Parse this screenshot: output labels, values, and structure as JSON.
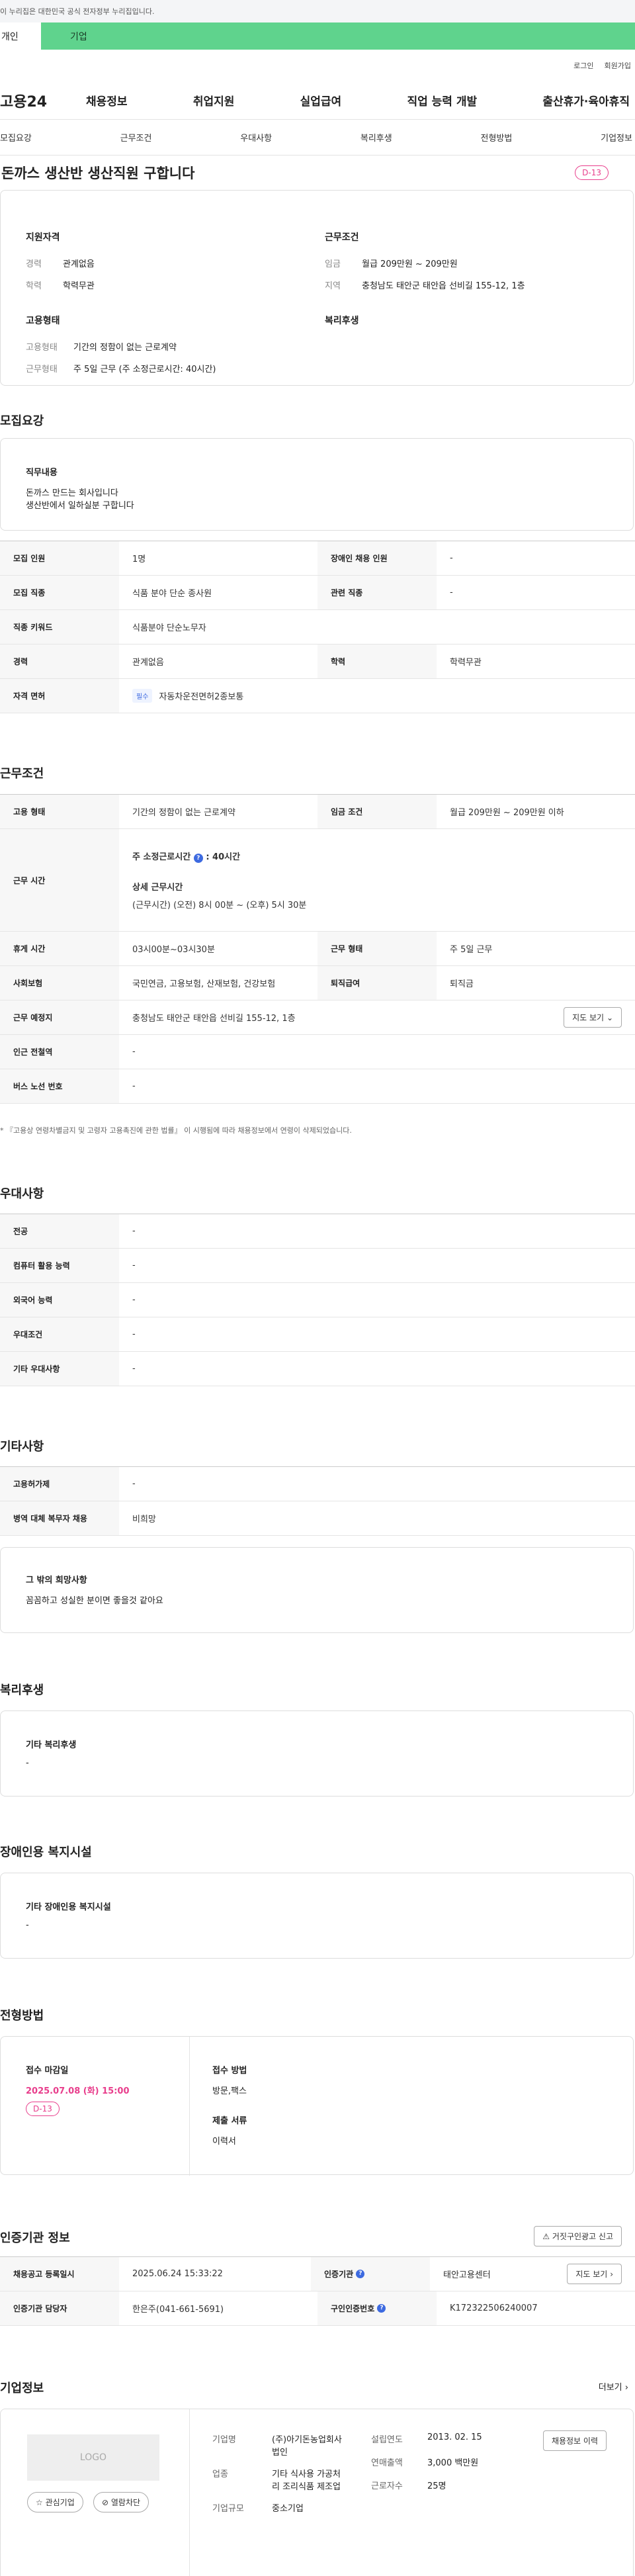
{
  "notice": "이 누리집은 대한민국 공식 전자정부 누리집입니다.",
  "orgtabs": [
    "개인",
    "기업"
  ],
  "util": [
    "로그인",
    "회원가입"
  ],
  "logo": "고용24",
  "gnb": [
    "채용정보",
    "취업지원",
    "실업급여",
    "직업 능력 개발",
    "출산휴가·육아휴직"
  ],
  "subnav": [
    "모집요강",
    "근무조건",
    "우대사항",
    "복리후생",
    "전형방법",
    "기업정보"
  ],
  "title": "돈까스 생산반 생산직원 구합니다",
  "dday": "D-13",
  "summary": {
    "qual_title": "지원자격",
    "career_k": "경력",
    "career_v": "관계없음",
    "edu_k": "학력",
    "edu_v": "학력무관",
    "emp_title": "고용형태",
    "emp1_k": "고용형태",
    "emp1_v": "기간의 정함이 없는 근로계약",
    "emp2_k": "근무형태",
    "emp2_v": "주 5일 근무 (주 소정근로시간: 40시간)",
    "work_title": "근무조건",
    "wage_k": "임금",
    "wage_v": "월급 209만원 ~ 209만원",
    "area_k": "지역",
    "area_v": "충청남도 태안군 태안읍 선비길 155-12, 1층",
    "welfare_title": "복리후생"
  },
  "recruit": {
    "title": "모집요강",
    "duty_title": "직무내용",
    "duty1": "돈까스 만드는 회사입니다",
    "duty2": "생산반에서 일하실분 구합니다",
    "rows": [
      {
        "k1": "모집 인원",
        "v1": "1명",
        "k2": "장애인 채용 인원",
        "v2": "-"
      },
      {
        "k1": "모집 직종",
        "v1": "식품 분야 단순 종사원",
        "k2": "관련 직종",
        "v2": "-"
      },
      {
        "k": "직종 키워드",
        "v": "식품분야 단순노무자"
      },
      {
        "k1": "경력",
        "v1": "관계없음",
        "k2": "학력",
        "v2": "학력무관"
      }
    ],
    "lic_k": "자격 면허",
    "lic_tag": "필수",
    "lic_v": "자동차운전면허2종보통"
  },
  "cond": {
    "title": "근무조건",
    "emp_k": "고용 형태",
    "emp_v": "기간의 정함이 없는 근로계약",
    "wage_k": "임금 조건",
    "wage_v": "월급 209만원 ~ 209만원 이하",
    "time_k": "근무 시간",
    "time_l1": "주 소정근로시간",
    "time_l1v": ": 40시간",
    "time_l2": "상세 근무시간",
    "time_l3": "(근무시간) (오전) 8시 00분 ~ (오후) 5시 30분",
    "rest_k": "휴게 시간",
    "rest_v": "03시00분~03시30분",
    "form_k": "근무 형태",
    "form_v": "주 5일 근무",
    "ins_k": "사회보험",
    "ins_v": "국민연금, 고용보험, 산재보험, 건강보험",
    "ret_k": "퇴직급여",
    "ret_v": "퇴직금",
    "place_k": "근무 예정지",
    "place_v": "충청남도 태안군 태안읍 선비길 155-12, 1층",
    "map": "지도 보기",
    "sub_k": "인근 전철역",
    "sub_v": "-",
    "bus_k": "버스 노선 번호",
    "bus_v": "-",
    "note": "* 『고용상 연령차별금지 및 고령자 고용촉진에 관한 법률』 이 시행됨에 따라 채용정보에서 연령이 삭제되었습니다."
  },
  "pref": {
    "title": "우대사항",
    "rows": [
      {
        "k": "전공",
        "v": "-"
      },
      {
        "k": "컴퓨터 활용 능력",
        "v": "-"
      },
      {
        "k": "외국어 능력",
        "v": "-"
      },
      {
        "k": "우대조건",
        "v": "-"
      },
      {
        "k": "기타 우대사항",
        "v": "-"
      }
    ]
  },
  "etc": {
    "title": "기타사항",
    "rows": [
      {
        "k": "고용허가제",
        "v": "-"
      },
      {
        "k": "병역 대체 복무자 채용",
        "v": "비희망"
      }
    ],
    "hope_title": "그 밖의 희망사항",
    "hope_v": "꼼꼼하고 성실한 분이면 좋을것 같아요"
  },
  "welfare": {
    "title": "복리후생",
    "sub": "기타 복리후생",
    "v": "-"
  },
  "disab": {
    "title": "장애인용 복지시설",
    "sub": "기타 장애인용 복지시설",
    "v": "-"
  },
  "select": {
    "title": "전형방법",
    "deadline_k": "접수 마감일",
    "deadline_v": "2025.07.08 (화) 15:00",
    "dday": "D-13",
    "method_k": "접수 방법",
    "method_v": "방문,팩스",
    "docs_k": "제출 서류",
    "docs_v": "이력서"
  },
  "auth": {
    "title": "인증기관 정보",
    "report": "거짓구인광고 신고",
    "reg_k": "채용공고 등록일시",
    "reg_v": "2025.06.24 15:33:22",
    "org_k": "인증기관",
    "org_v": "태안고용센터",
    "map": "지도 보기",
    "mgr_k": "인증기관 담당자",
    "mgr_v": "한은주(041-661-5691)",
    "no_k": "구인인증번호",
    "no_v": "K172322506240007"
  },
  "company": {
    "title": "기업정보",
    "more": "더보기",
    "logo": "LOGO",
    "fav": "관심기업",
    "block": "열람차단",
    "name_k": "기업명",
    "name_v": "(주)아기돈농업회사법인",
    "ind_k": "업종",
    "ind_v": "기타 식사용 가공처리 조리식품 제조업",
    "size_k": "기업규모",
    "size_v": "중소기업",
    "year_k": "설립연도",
    "year_v": "2013. 02. 15",
    "sales_k": "연매출액",
    "sales_v": "3,000 백만원",
    "emp_k": "근로자수",
    "emp_v": "25명",
    "hist": "채용정보 이력"
  }
}
